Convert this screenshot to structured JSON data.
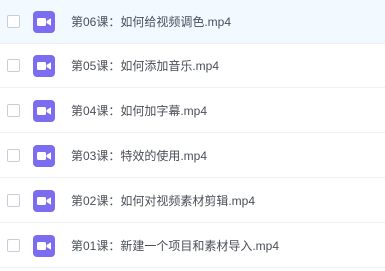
{
  "files": [
    {
      "name": "第06课：如何给视频调色.mp4",
      "icon": "video-file-icon",
      "highlighted": true
    },
    {
      "name": "第05课：如何添加音乐.mp4",
      "icon": "video-file-icon",
      "highlighted": false
    },
    {
      "name": "第04课：如何加字幕.mp4",
      "icon": "video-file-icon",
      "highlighted": false
    },
    {
      "name": "第03课：特效的使用.mp4",
      "icon": "video-file-icon",
      "highlighted": false
    },
    {
      "name": "第02课：如何对视频素材剪辑.mp4",
      "icon": "video-file-icon",
      "highlighted": false
    },
    {
      "name": "第01课：新建一个项目和素材导入.mp4",
      "icon": "video-file-icon",
      "highlighted": false
    }
  ],
  "colors": {
    "icon_bg": "#7c6cf0",
    "row_highlight": "#f2f9ff",
    "text": "#4a4f57",
    "divider": "#eef0f3"
  }
}
